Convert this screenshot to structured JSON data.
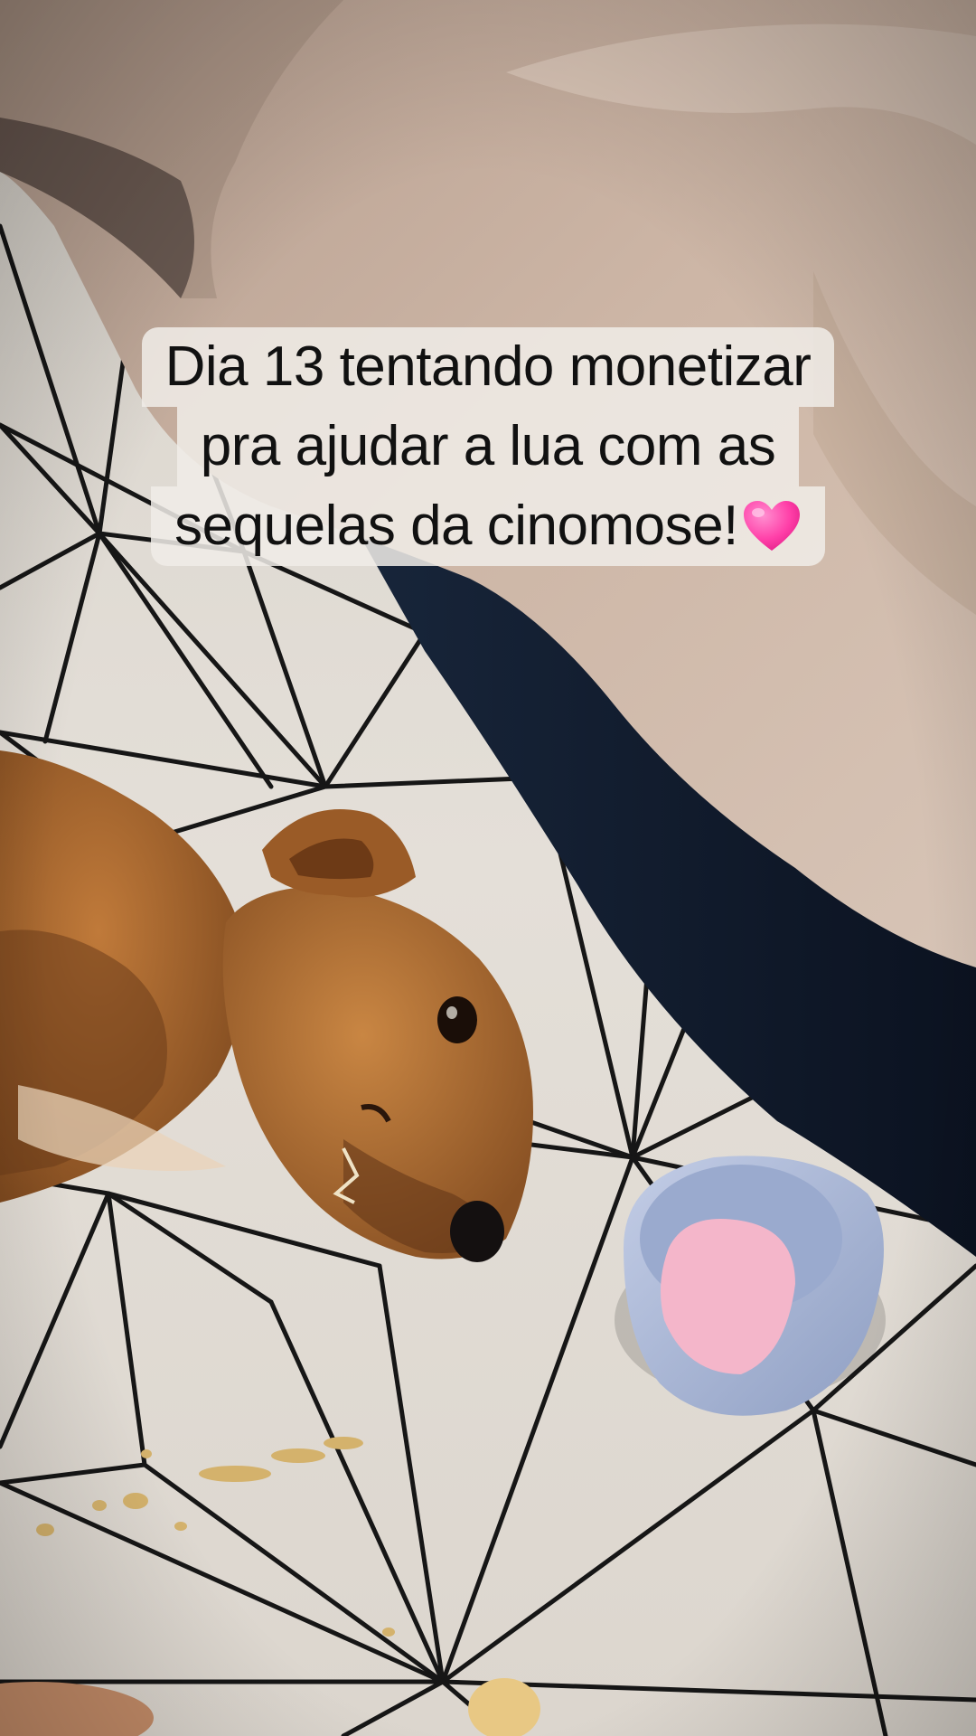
{
  "caption": {
    "line1": "Dia 13 tentando monetizar",
    "line2": "pra ajudar a lua com as",
    "line3": "sequelas da cinomose!",
    "emoji": "pink-heart-icon"
  },
  "colors": {
    "caption_bg": "#f0ece8",
    "caption_text": "#111111",
    "heart": "#ff3fa8",
    "rug": "#e2ddd6",
    "rug_lines": "#141414",
    "blanket": "#cbb3a2",
    "sofa": "#0f1a2c",
    "dog": "#a8662e",
    "bowl": "#aab8d8",
    "bowl_liquid": "#f3b4c8"
  }
}
